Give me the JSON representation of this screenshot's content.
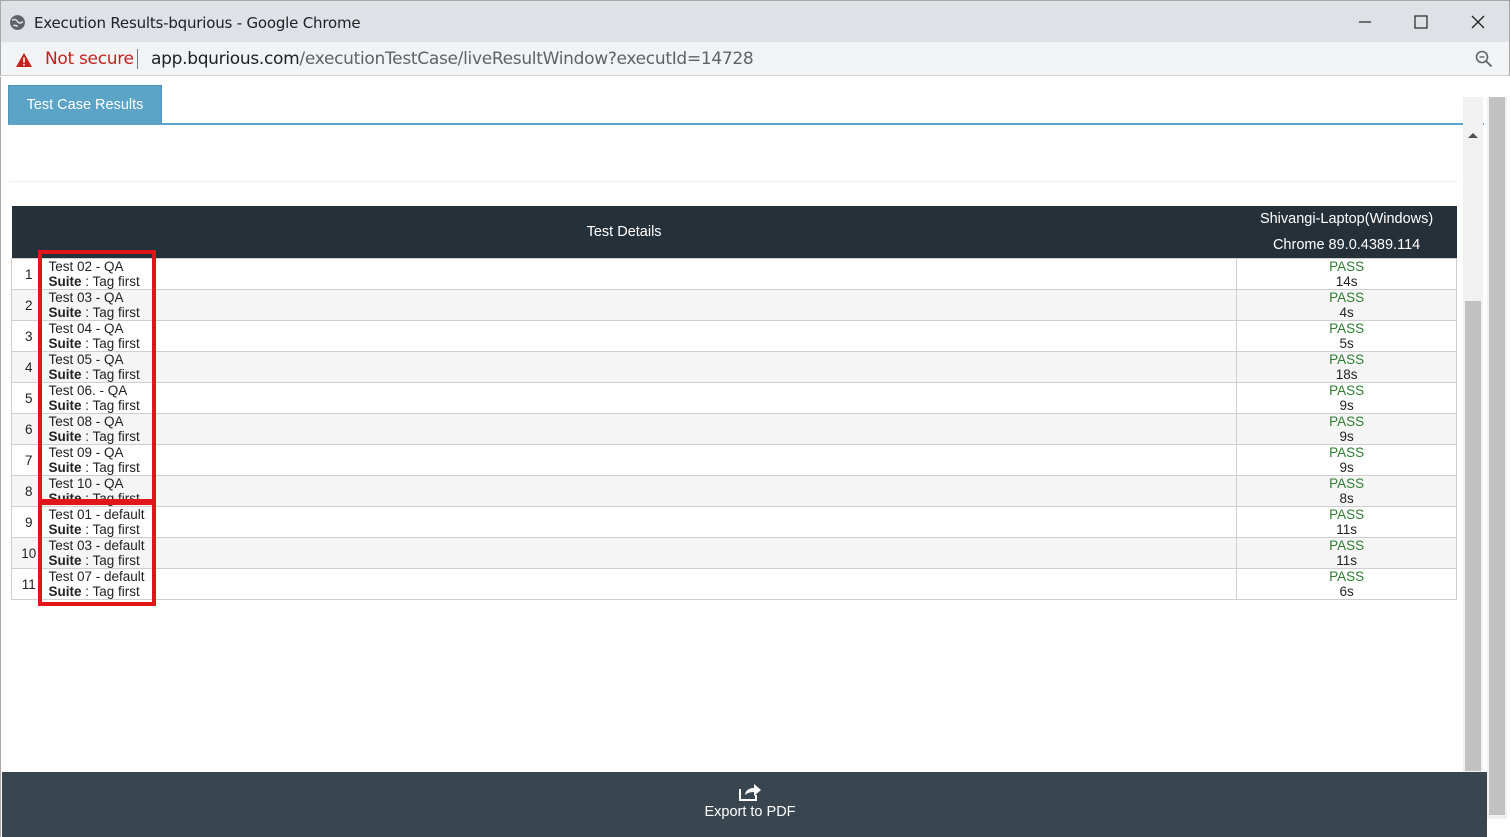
{
  "window": {
    "title": "Execution Results-bqurious - Google Chrome"
  },
  "address_bar": {
    "security_label": "Not secure",
    "url_host": "app.bqurious.com",
    "url_path": "/executionTestCase/liveResultWindow?executId=14728"
  },
  "tabs": [
    {
      "label": "Test Case Results",
      "active": true
    }
  ],
  "table": {
    "header_details": "Test Details",
    "header_env_machine": "Shivangi-Laptop(Windows)",
    "header_env_browser": "Chrome 89.0.4389.114",
    "suite_label": "Suite",
    "rows": [
      {
        "num": "1",
        "name": "Test 02 - QA",
        "suite": "Tag first",
        "status": "PASS",
        "time": "14s"
      },
      {
        "num": "2",
        "name": "Test 03 - QA",
        "suite": "Tag first",
        "status": "PASS",
        "time": "4s"
      },
      {
        "num": "3",
        "name": "Test 04 - QA",
        "suite": "Tag first",
        "status": "PASS",
        "time": "5s"
      },
      {
        "num": "4",
        "name": "Test 05 - QA",
        "suite": "Tag first",
        "status": "PASS",
        "time": "18s"
      },
      {
        "num": "5",
        "name": "Test 06. - QA",
        "suite": "Tag first",
        "status": "PASS",
        "time": "9s"
      },
      {
        "num": "6",
        "name": "Test 08 - QA",
        "suite": "Tag first",
        "status": "PASS",
        "time": "9s"
      },
      {
        "num": "7",
        "name": "Test 09 - QA",
        "suite": "Tag first",
        "status": "PASS",
        "time": "9s"
      },
      {
        "num": "8",
        "name": "Test 10 - QA",
        "suite": "Tag first",
        "status": "PASS",
        "time": "8s"
      },
      {
        "num": "9",
        "name": "Test 01 - default",
        "suite": "Tag first",
        "status": "PASS",
        "time": "11s"
      },
      {
        "num": "10",
        "name": "Test 03 - default",
        "suite": "Tag first",
        "status": "PASS",
        "time": "11s"
      },
      {
        "num": "11",
        "name": "Test 07 - default",
        "suite": "Tag first",
        "status": "PASS",
        "time": "6s"
      }
    ]
  },
  "footer": {
    "export_label": "Export to PDF"
  },
  "colors": {
    "tab_accent": "#5ba4c7",
    "table_header_bg": "#263038",
    "footer_bg": "#394650",
    "pass_text": "#2e7d32",
    "highlight_border": "#e0161b",
    "warning": "#c5221f"
  }
}
